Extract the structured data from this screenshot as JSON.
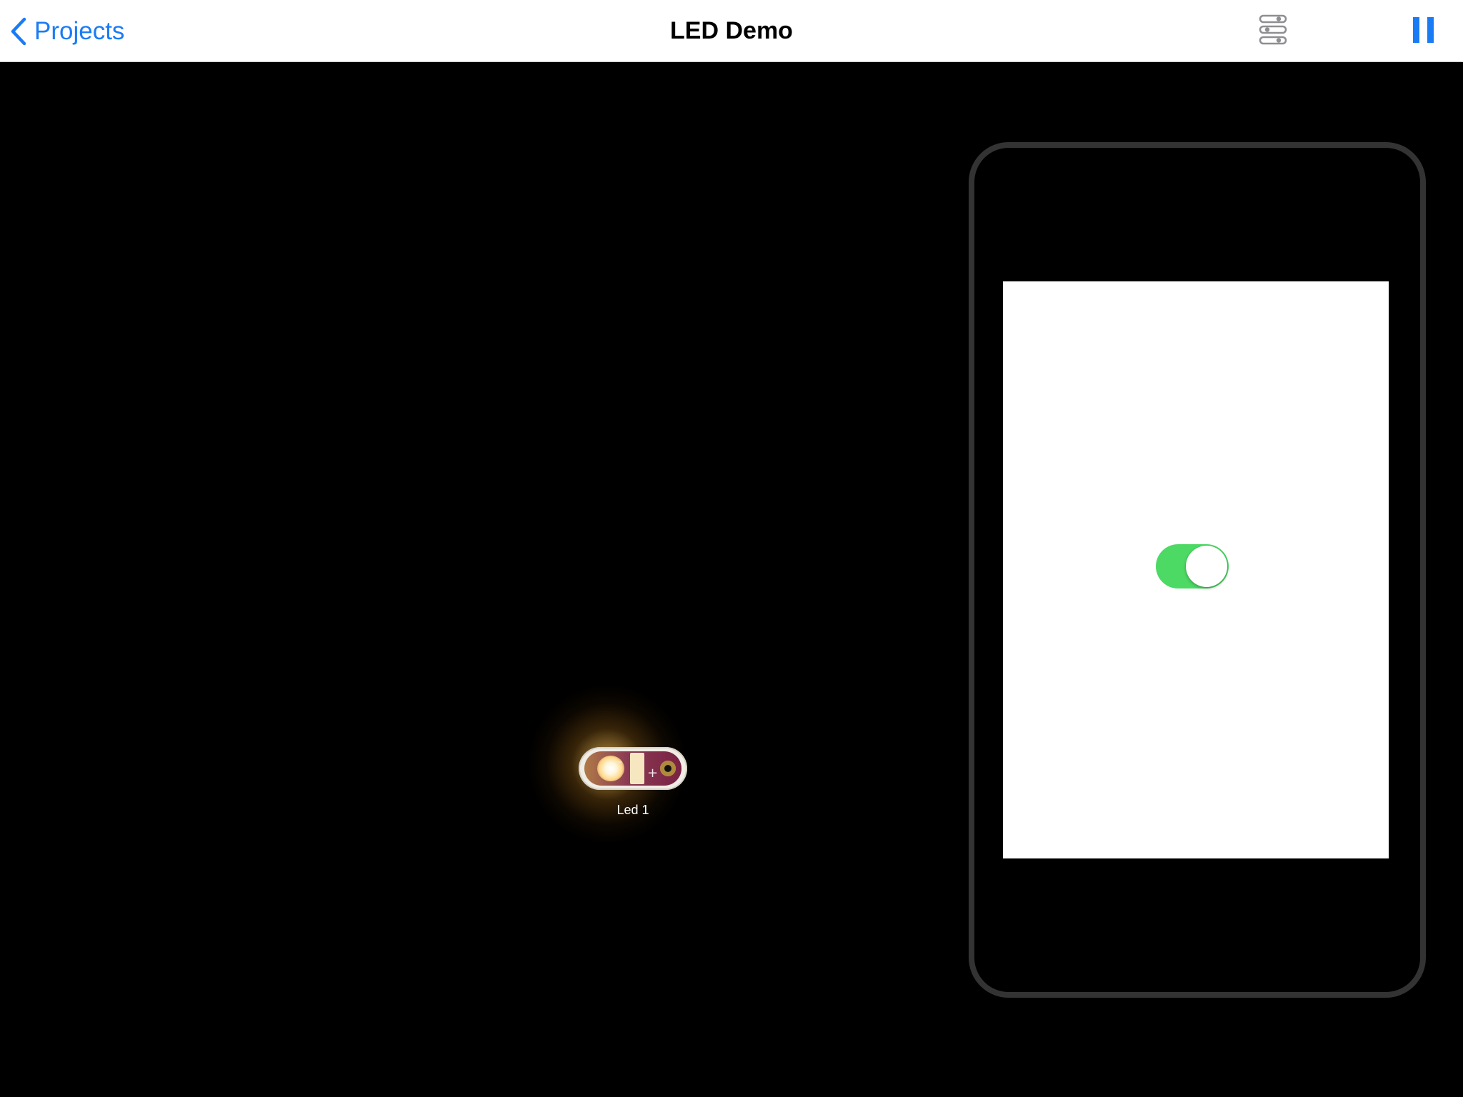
{
  "navbar": {
    "back_label": "Projects",
    "title": "LED Demo",
    "settings_icon": "sliders-icon",
    "pause_icon": "pause-icon",
    "accent_color": "#1a7cf5"
  },
  "canvas": {
    "led": {
      "label": "Led 1",
      "state": "on"
    },
    "device_preview": {
      "switch": {
        "state": "on",
        "color": "#4cd964"
      }
    }
  }
}
